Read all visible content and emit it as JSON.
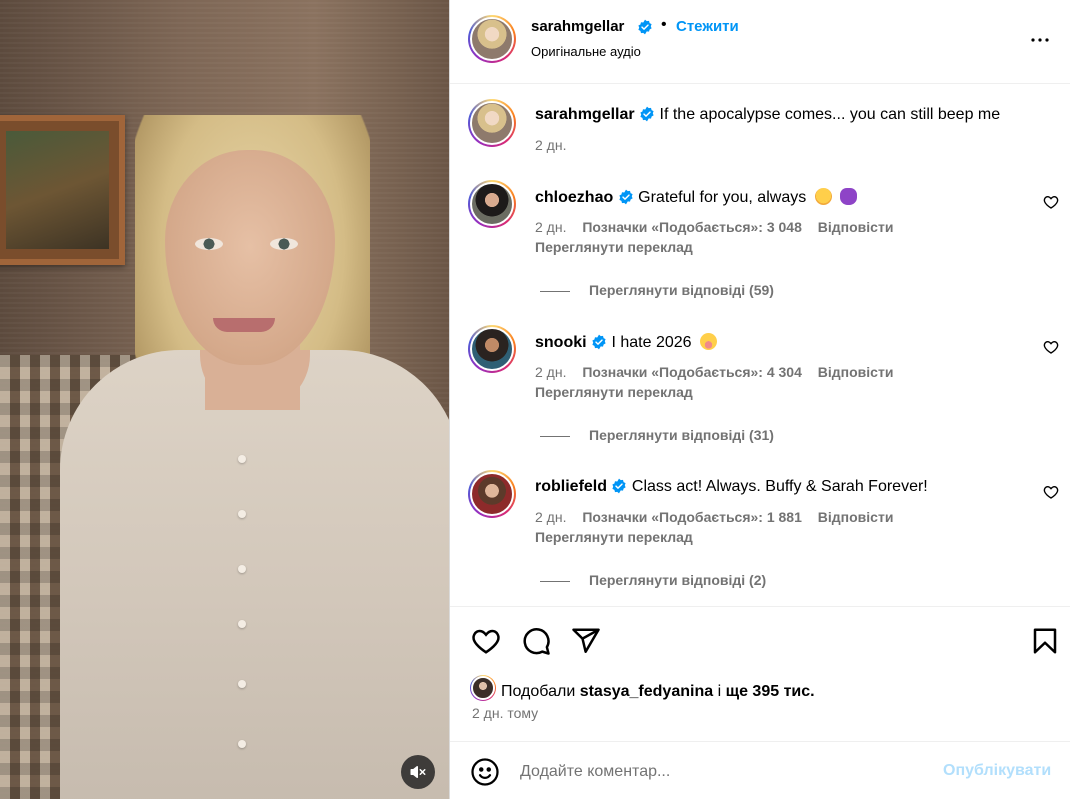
{
  "post": {
    "author": "sarahmgellar",
    "follow_label": "Стежити",
    "audio_label": "Оригінальне аудіо",
    "caption": "If the apocalypse comes... you can still beep me",
    "caption_time": "2 дн."
  },
  "comments": [
    {
      "username": "chloezhao",
      "text": "Grateful for you, always",
      "emoji": [
        "face-holding-back-tears-emoji",
        "purple-bear-emoji"
      ],
      "time": "2 дн.",
      "likes": "Позначки «Подобається»: 3 048",
      "reply_label": "Відповісти",
      "translate_label": "Переглянути переклад",
      "replies_label": "Переглянути відповіді (59)"
    },
    {
      "username": "snooki",
      "text": "I hate 2026",
      "emoji": [
        "flushed-face-emoji"
      ],
      "time": "2 дн.",
      "likes": "Позначки «Подобається»: 4 304",
      "reply_label": "Відповісти",
      "translate_label": "Переглянути переклад",
      "replies_label": "Переглянути відповіді (31)"
    },
    {
      "username": "robliefeld",
      "text": "Class act! Always. Buffy & Sarah Forever!",
      "emoji": [],
      "time": "2 дн.",
      "likes": "Позначки «Подобається»: 1 881",
      "reply_label": "Відповісти",
      "translate_label": "Переглянути переклад",
      "replies_label": "Переглянути відповіді (2)"
    }
  ],
  "engagement": {
    "liked_prefix": "Подобали",
    "liked_user": "stasya_fedyanina",
    "liked_mid": "і",
    "liked_rest": "ще 395 тис.",
    "post_date": "2 дн. тому"
  },
  "comment_input": {
    "placeholder": "Додайте коментар...",
    "publish_label": "Опублікувати"
  },
  "colors": {
    "accent": "#0095f6",
    "muted": "#737373",
    "publish_disabled": "#b2dffc",
    "verified": "#0095f6"
  },
  "icons": [
    "more-options-icon",
    "verified-badge-icon",
    "heart-icon",
    "comment-icon",
    "share-icon",
    "bookmark-icon",
    "emoji-smile-icon",
    "mute-icon"
  ]
}
